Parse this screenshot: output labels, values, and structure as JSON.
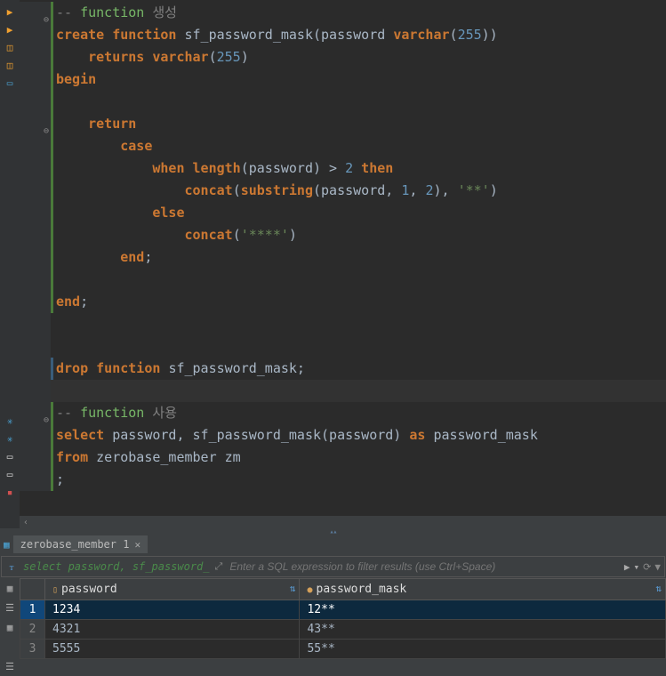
{
  "gutter_icons": [
    {
      "name": "run-icon",
      "glyph": "▶",
      "color": "#f0a030"
    },
    {
      "name": "run-new-icon",
      "glyph": "▶",
      "color": "#f0a030"
    },
    {
      "name": "script-icon",
      "glyph": "◫",
      "color": "#f0a030"
    },
    {
      "name": "script2-icon",
      "glyph": "◫",
      "color": "#f0a030"
    },
    {
      "name": "form-icon",
      "glyph": "▭",
      "color": "#4aa0d0"
    }
  ],
  "left_lower_icons": [
    {
      "name": "cog-icon",
      "glyph": "✳",
      "color": "#4aa0d0"
    },
    {
      "name": "cog2-icon",
      "glyph": "✳",
      "color": "#4aa0d0"
    },
    {
      "name": "file-icon",
      "glyph": "▭",
      "color": "#ddd"
    },
    {
      "name": "file2-icon",
      "glyph": "▭",
      "color": "#ddd"
    },
    {
      "name": "box-icon",
      "glyph": "▪",
      "color": "#d05050"
    }
  ],
  "code_lines": [
    {
      "bar": "green",
      "fold": "⊖",
      "tokens": [
        {
          "t": "-- ",
          "c": "cm"
        },
        {
          "t": "function",
          "c": "cmg"
        },
        {
          "t": " 생성",
          "c": "cm"
        }
      ]
    },
    {
      "bar": "green",
      "tokens": [
        {
          "t": "create function ",
          "c": "kw"
        },
        {
          "t": "sf_password_mask(password ",
          "c": "fn"
        },
        {
          "t": "varchar",
          "c": "kw"
        },
        {
          "t": "(",
          "c": "op"
        },
        {
          "t": "255",
          "c": "num"
        },
        {
          "t": "))",
          "c": "op"
        }
      ]
    },
    {
      "bar": "green",
      "tokens": [
        {
          "t": "    ",
          "c": "op"
        },
        {
          "t": "returns ",
          "c": "kw"
        },
        {
          "t": "varchar",
          "c": "kw"
        },
        {
          "t": "(",
          "c": "op"
        },
        {
          "t": "255",
          "c": "num"
        },
        {
          "t": ")",
          "c": "op"
        }
      ]
    },
    {
      "bar": "green",
      "tokens": [
        {
          "t": "begin",
          "c": "kw"
        }
      ]
    },
    {
      "bar": "green",
      "tokens": [
        {
          "t": "",
          "c": "op"
        }
      ]
    },
    {
      "bar": "green",
      "fold": "⊖",
      "tokens": [
        {
          "t": "    ",
          "c": "op"
        },
        {
          "t": "return",
          "c": "kw"
        }
      ]
    },
    {
      "bar": "green",
      "tokens": [
        {
          "t": "        ",
          "c": "op"
        },
        {
          "t": "case",
          "c": "kw"
        }
      ]
    },
    {
      "bar": "green",
      "tokens": [
        {
          "t": "            ",
          "c": "op"
        },
        {
          "t": "when ",
          "c": "kw"
        },
        {
          "t": "length",
          "c": "kw"
        },
        {
          "t": "(password) > ",
          "c": "fn"
        },
        {
          "t": "2",
          "c": "num"
        },
        {
          "t": " then",
          "c": "kw"
        }
      ]
    },
    {
      "bar": "green",
      "tokens": [
        {
          "t": "                ",
          "c": "op"
        },
        {
          "t": "concat",
          "c": "kw"
        },
        {
          "t": "(",
          "c": "op"
        },
        {
          "t": "substring",
          "c": "kw"
        },
        {
          "t": "(password, ",
          "c": "fn"
        },
        {
          "t": "1",
          "c": "num"
        },
        {
          "t": ", ",
          "c": "fn"
        },
        {
          "t": "2",
          "c": "num"
        },
        {
          "t": "), ",
          "c": "fn"
        },
        {
          "t": "'**'",
          "c": "str"
        },
        {
          "t": ")",
          "c": "op"
        }
      ]
    },
    {
      "bar": "green",
      "tokens": [
        {
          "t": "            ",
          "c": "op"
        },
        {
          "t": "else",
          "c": "kw"
        }
      ]
    },
    {
      "bar": "green",
      "tokens": [
        {
          "t": "                ",
          "c": "op"
        },
        {
          "t": "concat",
          "c": "kw"
        },
        {
          "t": "(",
          "c": "op"
        },
        {
          "t": "'****'",
          "c": "str"
        },
        {
          "t": ")",
          "c": "op"
        }
      ]
    },
    {
      "bar": "green",
      "tokens": [
        {
          "t": "        ",
          "c": "op"
        },
        {
          "t": "end",
          "c": "kw"
        },
        {
          "t": ";",
          "c": "op"
        }
      ]
    },
    {
      "bar": "green",
      "tokens": [
        {
          "t": "",
          "c": "op"
        }
      ]
    },
    {
      "bar": "green",
      "tokens": [
        {
          "t": "end",
          "c": "kw"
        },
        {
          "t": ";",
          "c": "op"
        }
      ]
    },
    {
      "bar": "",
      "tokens": [
        {
          "t": "",
          "c": "op"
        }
      ]
    },
    {
      "bar": "",
      "tokens": [
        {
          "t": "",
          "c": "op"
        }
      ]
    },
    {
      "bar": "blue",
      "tokens": [
        {
          "t": "drop function ",
          "c": "kw"
        },
        {
          "t": "sf_password_mask;",
          "c": "fn"
        }
      ]
    },
    {
      "bar": "",
      "hl": true,
      "tokens": [
        {
          "t": "",
          "c": "op"
        }
      ]
    },
    {
      "bar": "green",
      "fold": "⊖",
      "tokens": [
        {
          "t": "-- ",
          "c": "cm"
        },
        {
          "t": "function",
          "c": "cmg"
        },
        {
          "t": " 사용",
          "c": "cm"
        }
      ]
    },
    {
      "bar": "green",
      "tokens": [
        {
          "t": "select ",
          "c": "kw"
        },
        {
          "t": "password, sf_password_mask(password) ",
          "c": "fn"
        },
        {
          "t": "as ",
          "c": "kw"
        },
        {
          "t": "password_mask",
          "c": "fn"
        }
      ]
    },
    {
      "bar": "green",
      "tokens": [
        {
          "t": "from ",
          "c": "kw"
        },
        {
          "t": "zerobase_member zm",
          "c": "fn"
        }
      ]
    },
    {
      "bar": "green",
      "tokens": [
        {
          "t": ";",
          "c": "op"
        }
      ]
    }
  ],
  "tab": {
    "label": "zerobase_member 1"
  },
  "filter": {
    "sql_preview": "select password, sf_password_",
    "placeholder": "Enter a SQL expression to filter results (use Ctrl+Space)"
  },
  "columns": [
    {
      "label": "password"
    },
    {
      "label": "password_mask"
    }
  ],
  "rows": [
    {
      "n": "1",
      "password": "1234",
      "mask": "12**",
      "sel": true
    },
    {
      "n": "2",
      "password": "4321",
      "mask": "43**"
    },
    {
      "n": "3",
      "password": "5555",
      "mask": "55**"
    }
  ],
  "results_gutter": [
    {
      "name": "grid-icon",
      "glyph": "▦"
    },
    {
      "name": "text-icon",
      "glyph": "☰"
    },
    {
      "name": "grid2-icon",
      "glyph": "▦"
    },
    {
      "name": "spacer",
      "glyph": ""
    },
    {
      "name": "record-icon",
      "glyph": "☰"
    }
  ]
}
